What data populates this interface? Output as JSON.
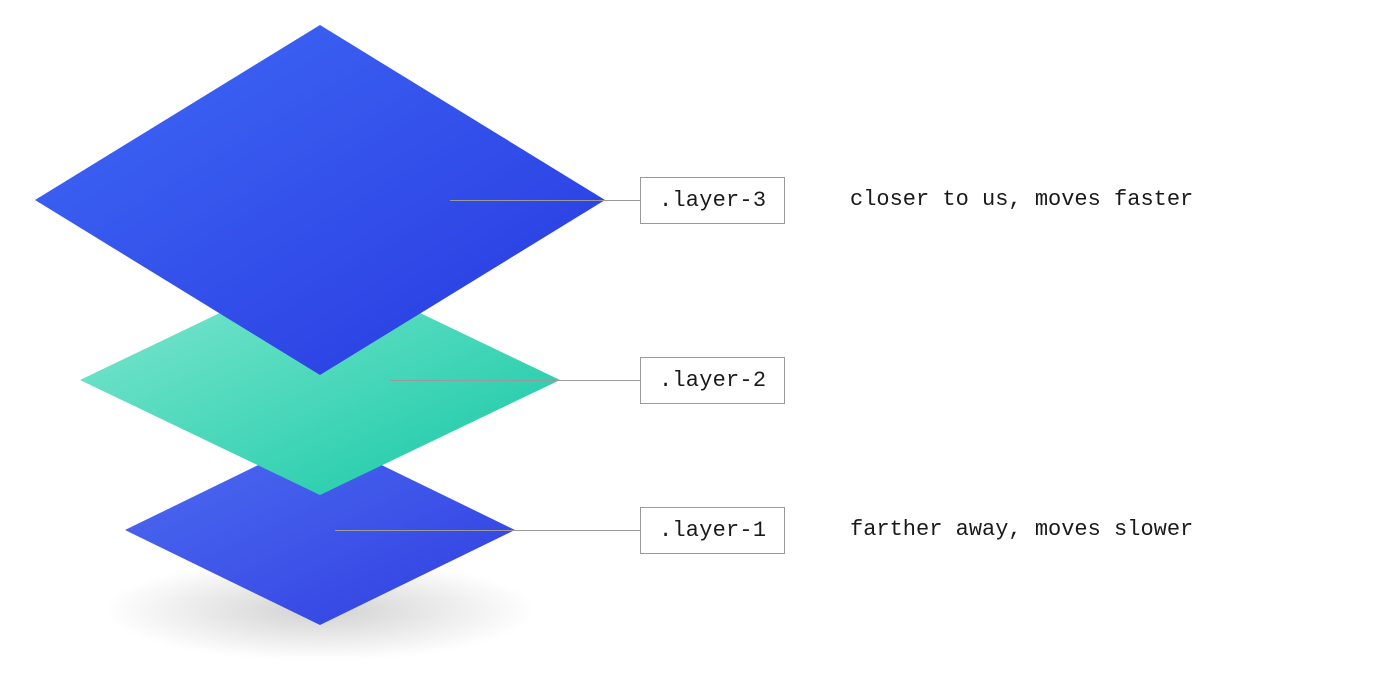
{
  "layers": [
    {
      "id": "layer-3",
      "label": ".layer-3",
      "description": "closer to us, moves faster"
    },
    {
      "id": "layer-2",
      "label": ".layer-2",
      "description": ""
    },
    {
      "id": "layer-1",
      "label": ".layer-1",
      "description": "farther away, moves slower"
    }
  ],
  "colors": {
    "layer3_light": "#3b63f2",
    "layer3_dark": "#2a3fe0",
    "layer2_light": "#7ce5cd",
    "layer2_dark": "#18c9a8",
    "layer1_light": "#4a66ef",
    "layer1_dark": "#3344dd",
    "border": "#9a9a9a"
  }
}
